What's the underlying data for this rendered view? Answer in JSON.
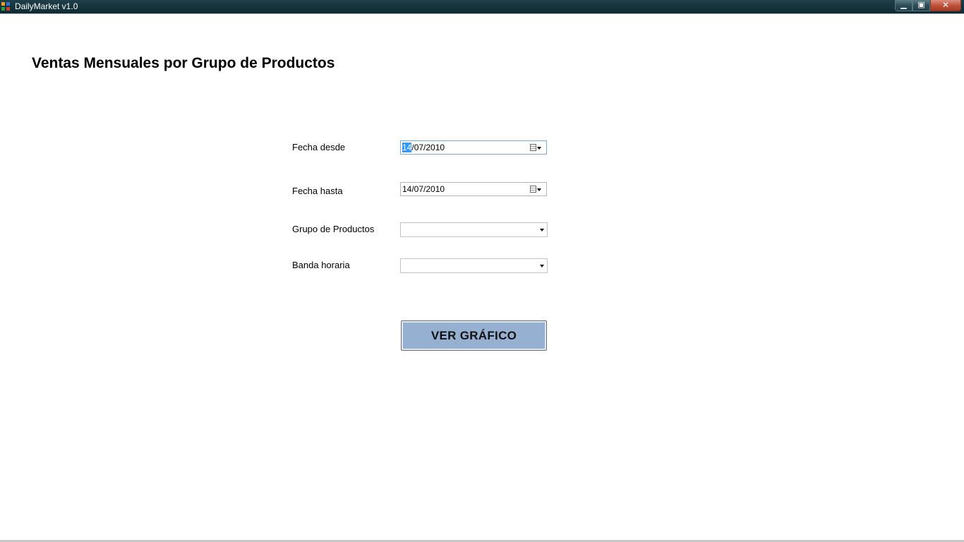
{
  "window": {
    "title": "DailyMarket v1.0",
    "controls": {
      "minimize": "▁",
      "maximize": "▣",
      "close": "✕"
    }
  },
  "page": {
    "title": "Ventas Mensuales por Grupo de Productos"
  },
  "form": {
    "fecha_desde": {
      "label": "Fecha desde",
      "value_selected": "14",
      "value_rest": "/07/2010"
    },
    "fecha_hasta": {
      "label": "Fecha hasta",
      "value": "14/07/2010"
    },
    "grupo_productos": {
      "label": "Grupo de Productos",
      "value": ""
    },
    "banda_horaria": {
      "label": "Banda horaria",
      "value": ""
    },
    "submit_label": "VER GRÁFICO"
  },
  "icons": {
    "app": "app-icon",
    "calendar": "calendar-icon",
    "dropdown": "chevron-down-icon"
  },
  "colors": {
    "button_fill": "#95b0d0",
    "selection": "#3399ff",
    "titlebar": "#16343d"
  }
}
